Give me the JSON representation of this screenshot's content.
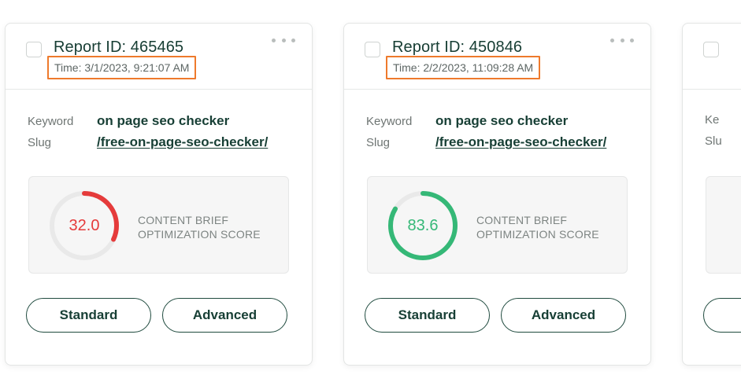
{
  "cards": [
    {
      "report_title": "Report ID: 465465",
      "time": "Time: 3/1/2023, 9:21:07 AM",
      "keyword_label": "Keyword",
      "keyword": "on page seo checker",
      "slug_label": "Slug",
      "slug": "/free-on-page-seo-checker/",
      "score": "32.0",
      "score_value": 32.0,
      "score_color": "#e53b3b",
      "score_label_line1": "CONTENT BRIEF",
      "score_label_line2": "OPTIMIZATION SCORE",
      "standard_label": "Standard",
      "advanced_label": "Advanced"
    },
    {
      "report_title": "Report ID: 450846",
      "time": "Time: 2/2/2023, 11:09:28 AM",
      "keyword_label": "Keyword",
      "keyword": "on page seo checker",
      "slug_label": "Slug",
      "slug": "/free-on-page-seo-checker/",
      "score": "83.6",
      "score_value": 83.6,
      "score_color": "#35b877",
      "score_label_line1": "CONTENT BRIEF",
      "score_label_line2": "OPTIMIZATION SCORE",
      "standard_label": "Standard",
      "advanced_label": "Advanced"
    },
    {
      "keyword_label": "Ke",
      "slug_label": "Slu"
    }
  ],
  "colors": {
    "highlight_border": "#ee7a2c",
    "button_border": "#1f4a3e",
    "gauge_track": "#e9e9e9"
  },
  "icons": {
    "more": "more-horizontal-icon",
    "checkbox": "checkbox-icon"
  }
}
